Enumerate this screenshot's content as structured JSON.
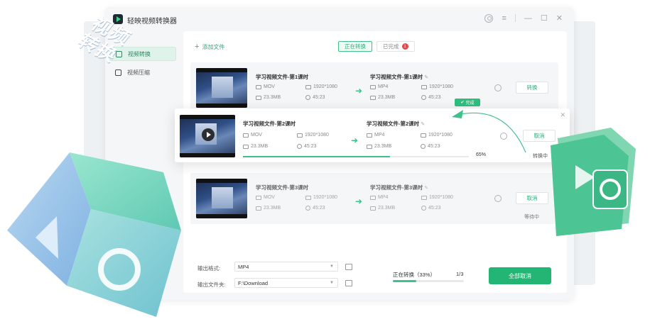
{
  "app": {
    "title": "轻映视频转换器"
  },
  "sidebar": {
    "items": [
      {
        "label": "视频转换",
        "active": true
      },
      {
        "label": "视频压缩",
        "active": false
      }
    ]
  },
  "toolbar": {
    "add_file": "添加文件"
  },
  "tabs": [
    {
      "label": "正在转换",
      "active": true
    },
    {
      "label": "已完成",
      "badge": "1"
    }
  ],
  "files": [
    {
      "source": {
        "name": "学习视频文件-第1课时",
        "format": "MOV",
        "resolution": "1920*1080",
        "size": "23.3MB",
        "duration": "45:23"
      },
      "target": {
        "name": "学习视频文件-第1课时",
        "format": "MP4",
        "resolution": "1920*1080",
        "size": "23.3MB",
        "duration": "45:23"
      },
      "action": "转换",
      "status": "完成"
    },
    {
      "source": {
        "name": "学习视频文件-第2课时",
        "format": "MOV",
        "resolution": "1920*1080",
        "size": "23.3MB",
        "duration": "45:23"
      },
      "target": {
        "name": "学习视频文件-第2课时",
        "format": "MP4",
        "resolution": "1920*1080",
        "size": "23.3MB",
        "duration": "45:23"
      },
      "action": "取消",
      "progress_label": "65%",
      "progress": 0.65,
      "status": "转换中"
    },
    {
      "source": {
        "name": "学习视频文件-第3课时",
        "format": "MOV",
        "resolution": "1920*1080",
        "size": "23.3MB",
        "duration": "45:23"
      },
      "target": {
        "name": "学习视频文件-第3课时",
        "format": "MP4",
        "resolution": "1920*1080",
        "size": "23.3MB",
        "duration": "45:23"
      },
      "action": "取消",
      "status": "等待中"
    }
  ],
  "bottom": {
    "format_label": "输出格式:",
    "format_value": "MP4",
    "folder_label": "输出文件夹:",
    "folder_value": "F:\\Download",
    "total_label": "正在转换（33%）",
    "total_progress": 0.33,
    "total_count": "1/3",
    "cancel_all": "全部取消"
  },
  "promo": {
    "cube_text": "视频转换"
  },
  "colors": {
    "accent": "#22b573",
    "accent_light": "#3ec28a",
    "badge": "#e54848"
  }
}
